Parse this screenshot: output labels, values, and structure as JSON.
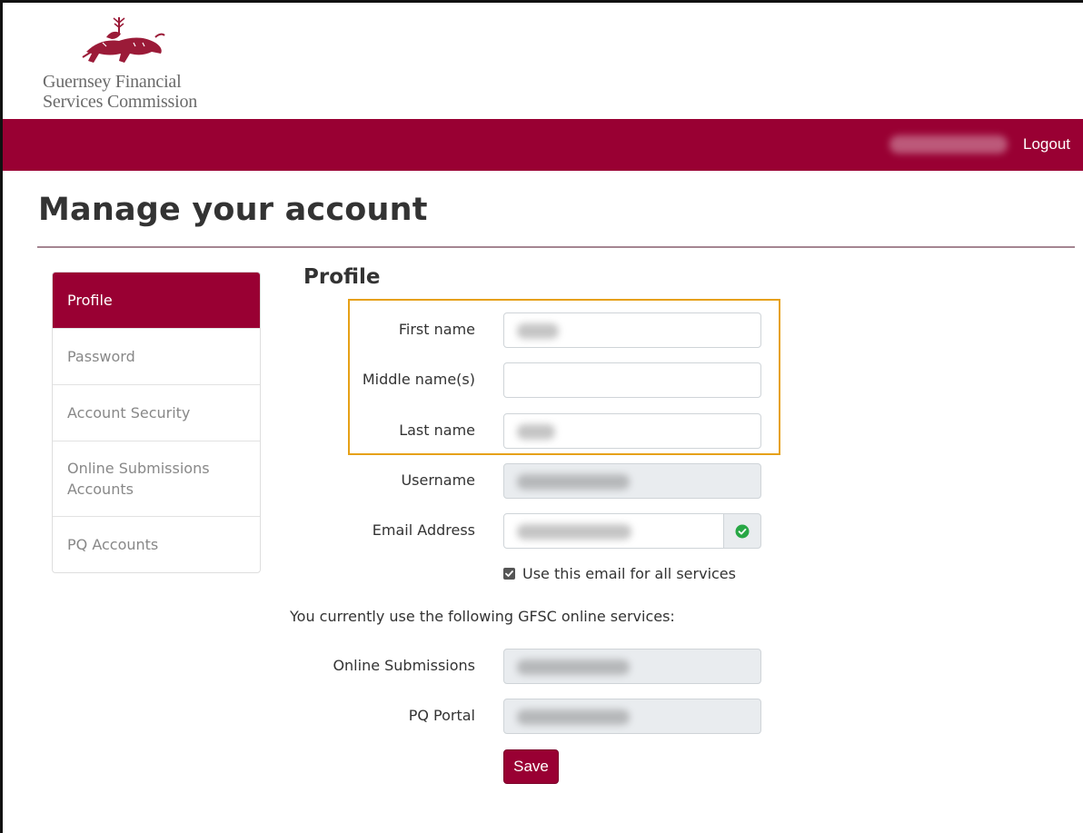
{
  "brand": {
    "name_line1": "Guernsey Financial",
    "name_line2": "Services Commission",
    "color": "#990033"
  },
  "navbar": {
    "logout_label": "Logout"
  },
  "page": {
    "title": "Manage your account"
  },
  "sidebar": {
    "items": [
      {
        "label": "Profile",
        "active": true
      },
      {
        "label": "Password",
        "active": false
      },
      {
        "label": "Account Security",
        "active": false
      },
      {
        "label": "Online Submissions Accounts",
        "active": false
      },
      {
        "label": "PQ Accounts",
        "active": false
      }
    ]
  },
  "profile": {
    "heading": "Profile",
    "fields": {
      "first_name_label": "First name",
      "middle_name_label": "Middle name(s)",
      "last_name_label": "Last name",
      "username_label": "Username",
      "email_label": "Email Address"
    },
    "email_verified_icon": "check-circle-icon",
    "use_email_all_services_label": "Use this email for all services",
    "use_email_all_services_checked": true,
    "services_intro": "You currently use the following GFSC online services:",
    "services": {
      "online_submissions_label": "Online Submissions",
      "pq_portal_label": "PQ Portal"
    },
    "save_label": "Save"
  },
  "colors": {
    "highlight_border": "#e6a117",
    "success_green": "#28a745"
  }
}
